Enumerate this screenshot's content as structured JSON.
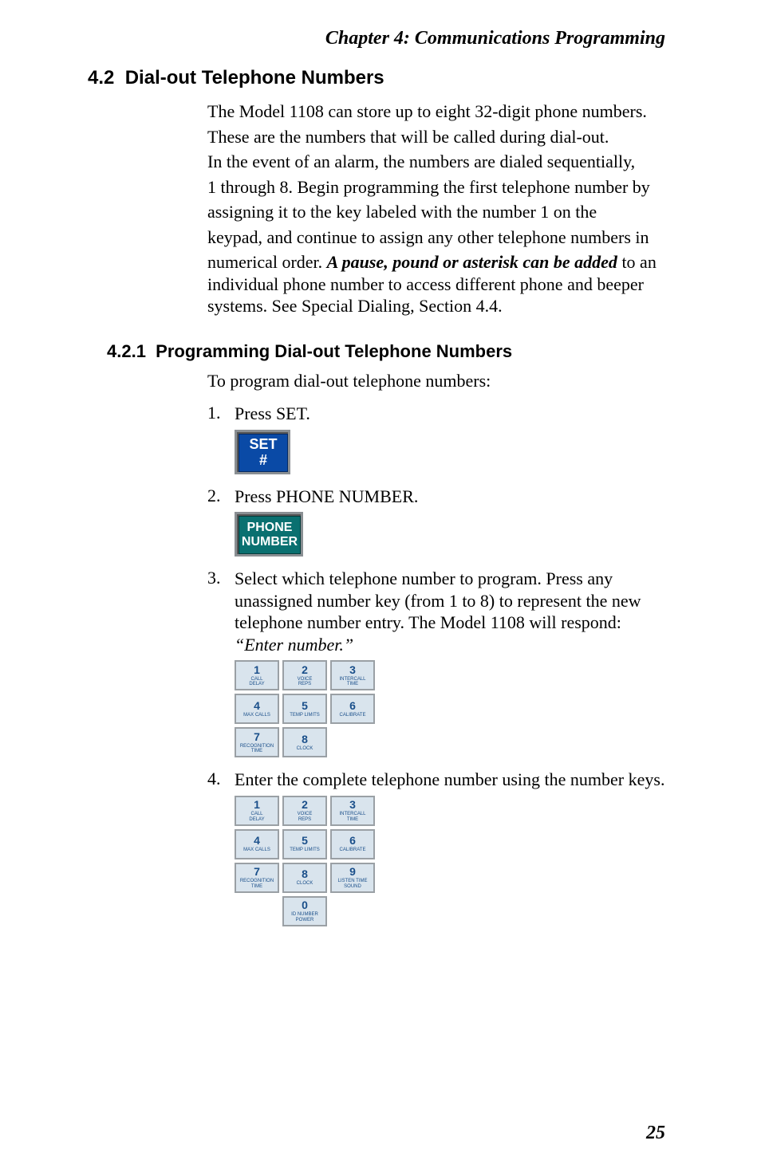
{
  "chapter_header": "Chapter  4:  Communications Programming",
  "section_4_2": {
    "number": "4.2",
    "title": "Dial-out Telephone Numbers",
    "body_lines": [
      "The Model 1108 can store up to eight 32-digit phone numbers.",
      "These are the numbers that will be called during dial-out.",
      "In the event of an alarm, the numbers are dialed sequentially,",
      "1 through 8. Begin programming the first telephone number by",
      "assigning it to the key labeled with the number 1 on the",
      "keypad, and continue to assign any other telephone numbers in",
      "numerical order. "
    ],
    "pause_phrase": "A pause, pound or asterisk can be added",
    "body_tail": " to an individual phone number to access different phone and beeper systems. See Special Dialing, Section 4.4."
  },
  "section_4_2_1": {
    "number": "4.2.1",
    "title": "Programming Dial-out Telephone Numbers",
    "intro": "To program dial-out telephone numbers:",
    "steps": [
      {
        "num": "1.",
        "text": "Press SET."
      },
      {
        "num": "2.",
        "text": "Press PHONE NUMBER."
      },
      {
        "num": "3.",
        "text": "Select which telephone number to program. Press any unassigned number key (from 1 to 8) to represent the new telephone number entry. The Model 1108 will respond:",
        "italic": "“Enter number.”"
      },
      {
        "num": "4.",
        "text": "Enter the complete telephone number using the number keys."
      }
    ]
  },
  "keys": {
    "set": {
      "line1": "SET",
      "line2": "#"
    },
    "phone": {
      "line1": "PHONE",
      "line2": "NUMBER"
    },
    "numpad": [
      {
        "n": "1",
        "label": "CALL\nDELAY"
      },
      {
        "n": "2",
        "label": "VOICE\nREPS"
      },
      {
        "n": "3",
        "label": "INTERCALL\nTIME"
      },
      {
        "n": "4",
        "label": "MAX CALLS"
      },
      {
        "n": "5",
        "label": "TEMP LIMITS"
      },
      {
        "n": "6",
        "label": "CALIBRATE"
      },
      {
        "n": "7",
        "label": "RECOGNITION\nTIME"
      },
      {
        "n": "8",
        "label": "CLOCK"
      },
      {
        "n": "9",
        "label": "LISTEN TIME\nSOUND"
      },
      {
        "n": "0",
        "label": "ID NUMBER\nPOWER"
      }
    ]
  },
  "page_number": "25"
}
